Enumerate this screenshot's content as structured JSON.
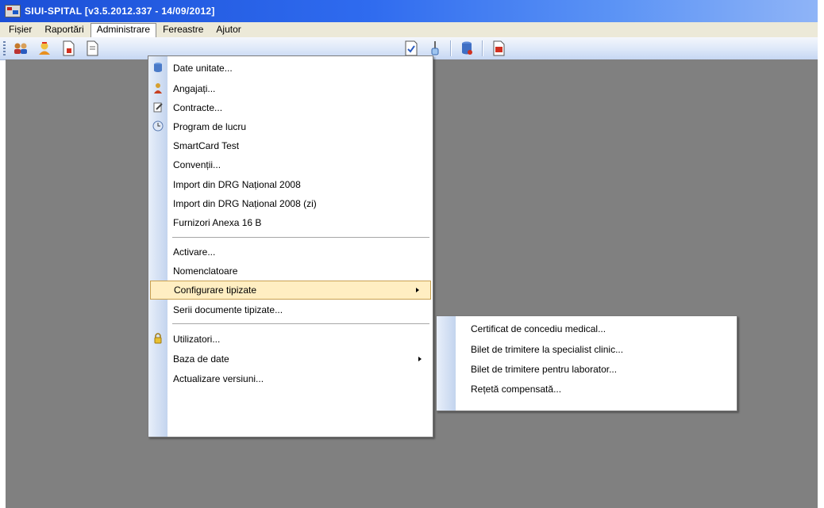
{
  "window": {
    "title": "SIUI-SPITAL [v3.5.2012.337 - 14/09/2012]"
  },
  "menubar": {
    "items": [
      "Fișier",
      "Raportări",
      "Administrare",
      "Fereastre",
      "Ajutor"
    ],
    "active": "Administrare"
  },
  "toolbar": {
    "icons": [
      "users-icon",
      "doctor-icon",
      "document-icon",
      "document-icon",
      "checklist-icon",
      "syringe-icon",
      "database-icon",
      "report-icon"
    ]
  },
  "admin_menu": {
    "items": [
      {
        "label": "Date unitate...",
        "icon": "database-icon"
      },
      {
        "label": "Angajați...",
        "icon": "employee-icon"
      },
      {
        "label": "Contracte...",
        "icon": "contract-icon"
      },
      {
        "label": "Program de lucru",
        "icon": "clock-icon"
      },
      {
        "label": "SmartCard Test"
      },
      {
        "label": "Convenții..."
      },
      {
        "label": "Import din DRG Național 2008"
      },
      {
        "label": "Import din DRG Național 2008 (zi)"
      },
      {
        "label": "Furnizori Anexa 16 B"
      },
      {
        "label": "Activare..."
      },
      {
        "label": "Nomenclatoare"
      },
      {
        "label": "Configurare tipizate",
        "submenu": true,
        "highlighted": true
      },
      {
        "label": "Serii documente tipizate..."
      },
      {
        "label": "Utilizatori...",
        "icon": "lock-icon"
      },
      {
        "label": "Baza de date",
        "submenu": true
      },
      {
        "label": "Actualizare versiuni..."
      }
    ]
  },
  "submenu": {
    "items": [
      "Certificat de concediu medical...",
      "Bilet de trimitere la specialist clinic...",
      "Bilet de trimitere pentru laborator...",
      "Rețetă compensată..."
    ]
  },
  "colors": {
    "titlebar": "#2f6bef",
    "menubar": "#ece9d8",
    "mdi_background": "#808080",
    "highlight": "#ffeec2"
  }
}
